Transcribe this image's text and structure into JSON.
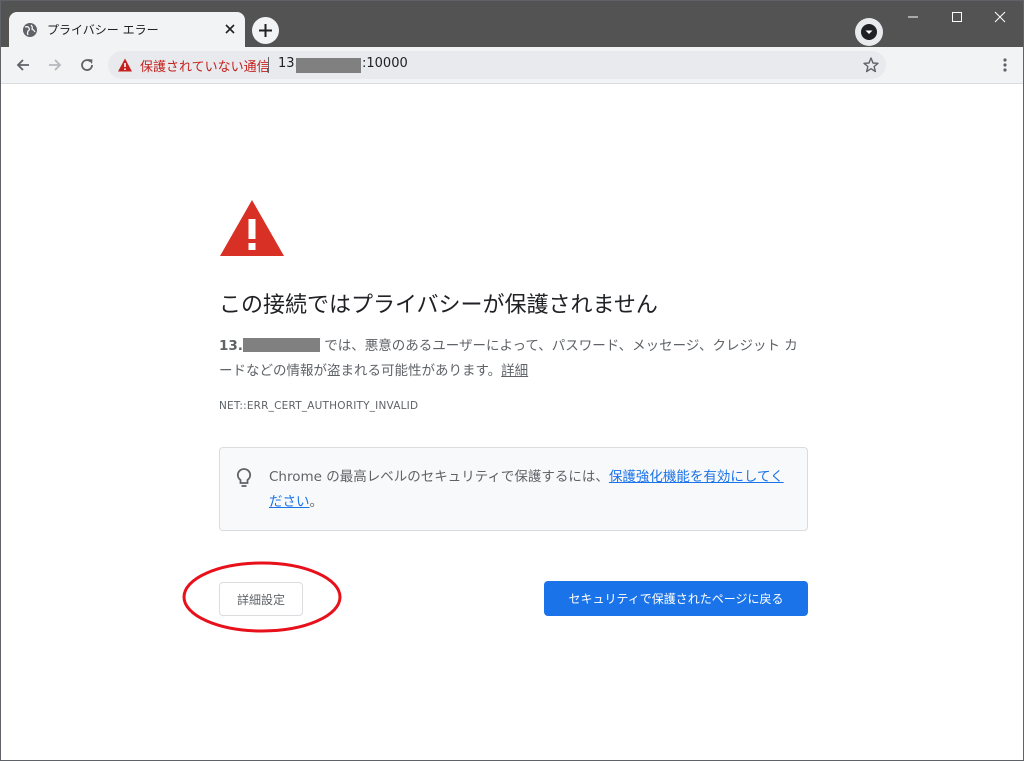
{
  "tab": {
    "title": "プライバシー エラー",
    "favicon": "globe-icon"
  },
  "toolbar": {
    "security_label": "保護されていない通信",
    "url_prefix": "13.",
    "url_suffix": ":10000"
  },
  "page": {
    "heading": "この接続ではプライバシーが保護されません",
    "host_prefix": "13.",
    "desc_text": " では、悪意のあるユーザーによって、パスワード、メッセージ、クレジット カードなどの情報が盗まれる可能性があります。",
    "details_link": "詳細",
    "error_code": "NET::ERR_CERT_AUTHORITY_INVALID",
    "tip_text": "Chrome の最高レベルのセキュリティで保護するには、",
    "tip_link": "保護強化機能を有効にしてください",
    "tip_end": "。",
    "advanced_button": "詳細設定",
    "back_button": "セキュリティで保護されたページに戻る"
  },
  "colors": {
    "warning_red": "#d93025",
    "link_blue": "#1a73e8",
    "annotation_red": "#e8101a"
  }
}
